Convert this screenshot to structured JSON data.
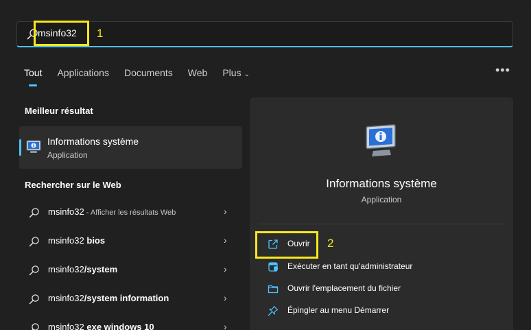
{
  "search": {
    "query": "msinfo32"
  },
  "annotations": {
    "one": "1",
    "two": "2"
  },
  "tabs": [
    {
      "label": "Tout"
    },
    {
      "label": "Applications"
    },
    {
      "label": "Documents"
    },
    {
      "label": "Web"
    },
    {
      "label": "Plus"
    }
  ],
  "more_label": "•••",
  "best_match": {
    "heading": "Meilleur résultat",
    "title": "Informations système",
    "subtitle": "Application"
  },
  "web": {
    "heading": "Rechercher sur le Web",
    "items": [
      {
        "prefix": "msinfo32",
        "bold": "",
        "hint": " - Afficher les résultats Web"
      },
      {
        "prefix": "msinfo32 ",
        "bold": "bios",
        "hint": ""
      },
      {
        "prefix": "msinfo32",
        "bold": "/system",
        "hint": ""
      },
      {
        "prefix": "msinfo32",
        "bold": "/system information",
        "hint": ""
      },
      {
        "prefix": "msinfo32 ",
        "bold": "exe windows 10",
        "hint": ""
      }
    ]
  },
  "detail": {
    "title": "Informations système",
    "subtitle": "Application",
    "actions": [
      {
        "label": "Ouvrir",
        "icon": "open-external-icon"
      },
      {
        "label": "Exécuter en tant qu'administrateur",
        "icon": "admin-shield-icon"
      },
      {
        "label": "Ouvrir l'emplacement du fichier",
        "icon": "folder-icon"
      },
      {
        "label": "Épingler au menu Démarrer",
        "icon": "pin-icon"
      }
    ]
  },
  "colors": {
    "accent": "#4cc2ff",
    "annotation": "#f8e81c",
    "background": "#202020"
  }
}
